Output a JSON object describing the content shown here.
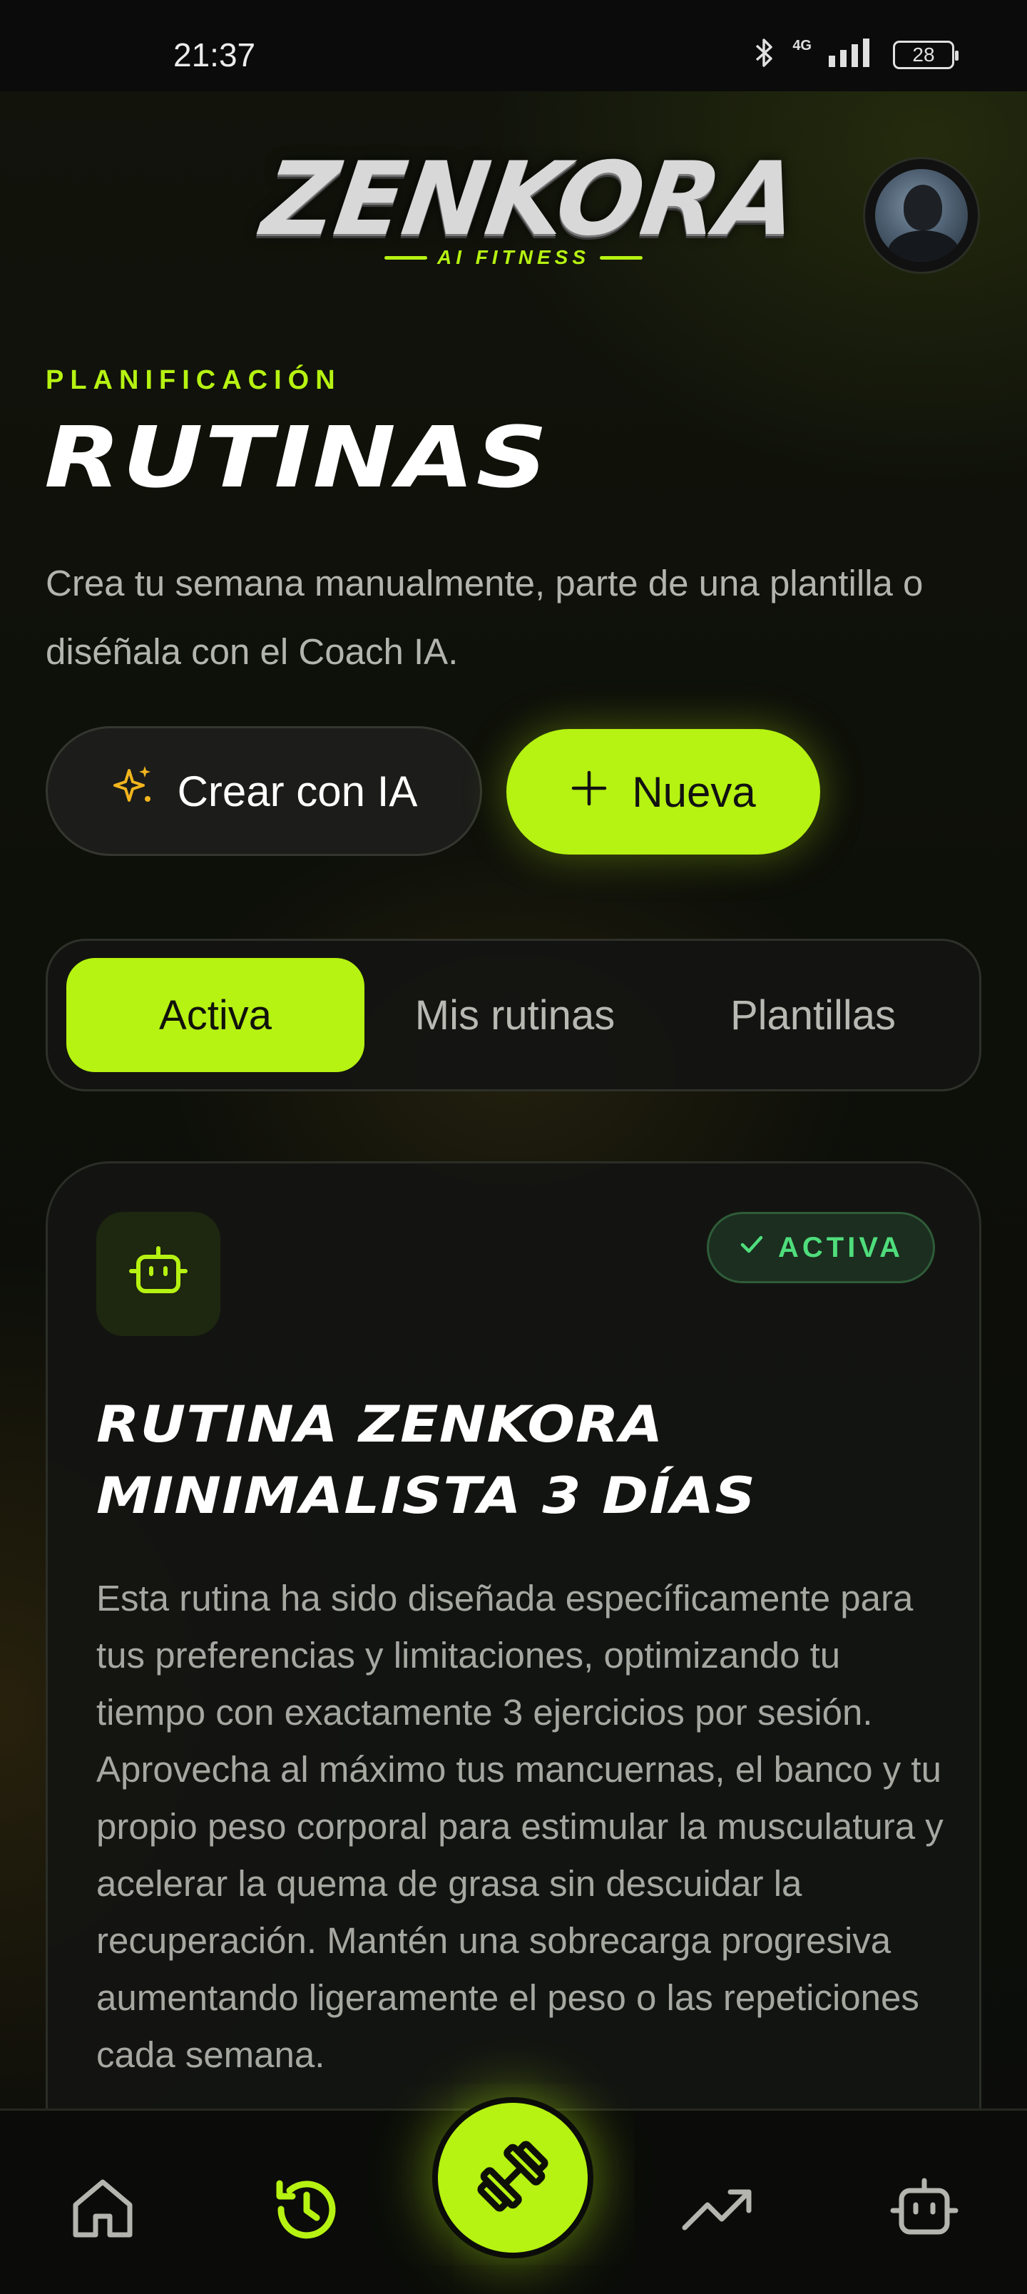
{
  "status_bar": {
    "time": "21:37",
    "network": "4G",
    "battery": "28",
    "icons": [
      "bluetooth-icon",
      "signal-icon",
      "battery-icon"
    ]
  },
  "header": {
    "logo_title": "ZENKORA",
    "logo_subtitle": "AI FITNESS",
    "avatar": "profile-avatar"
  },
  "page": {
    "eyebrow": "PLANIFICACIÓN",
    "title": "RUTINAS",
    "description": "Crea tu semana manualmente, parte de una plantilla o diséñala con el Coach IA."
  },
  "actions": {
    "create_ai_label": "Crear con IA",
    "create_ai_icon": "sparkles-icon",
    "new_label": "Nueva",
    "new_icon": "plus-icon"
  },
  "tabs": [
    {
      "label": "Activa",
      "active": true
    },
    {
      "label": "Mis rutinas",
      "active": false
    },
    {
      "label": "Plantillas",
      "active": false
    }
  ],
  "routine_card": {
    "icon": "robot-icon",
    "status_badge": "ACTIVA",
    "title_line1": "RUTINA ZENKORA",
    "title_line2": "MINIMALISTA 3 DÍAS",
    "description": "Esta rutina ha sido diseñada específicamente para tus preferencias y limitaciones, optimizando tu tiempo con exactamente 3 ejercicios por sesión. Aprovecha al máximo tus mancuernas, el banco y tu propio peso corporal para estimular la musculatura y acelerar la quema de grasa sin descuidar la recuperación. Mantén una sobrecarga progresiva aumentando ligeramente el peso o las repeticiones cada semana."
  },
  "bottom_nav": {
    "items": [
      "home-icon",
      "history-icon",
      "dumbbell-icon",
      "trending-up-icon",
      "robot-icon"
    ],
    "active": "history-icon"
  },
  "colors": {
    "accent": "#b6f212",
    "background": "#0d0f09",
    "active_badge": "#4fdd7c"
  }
}
